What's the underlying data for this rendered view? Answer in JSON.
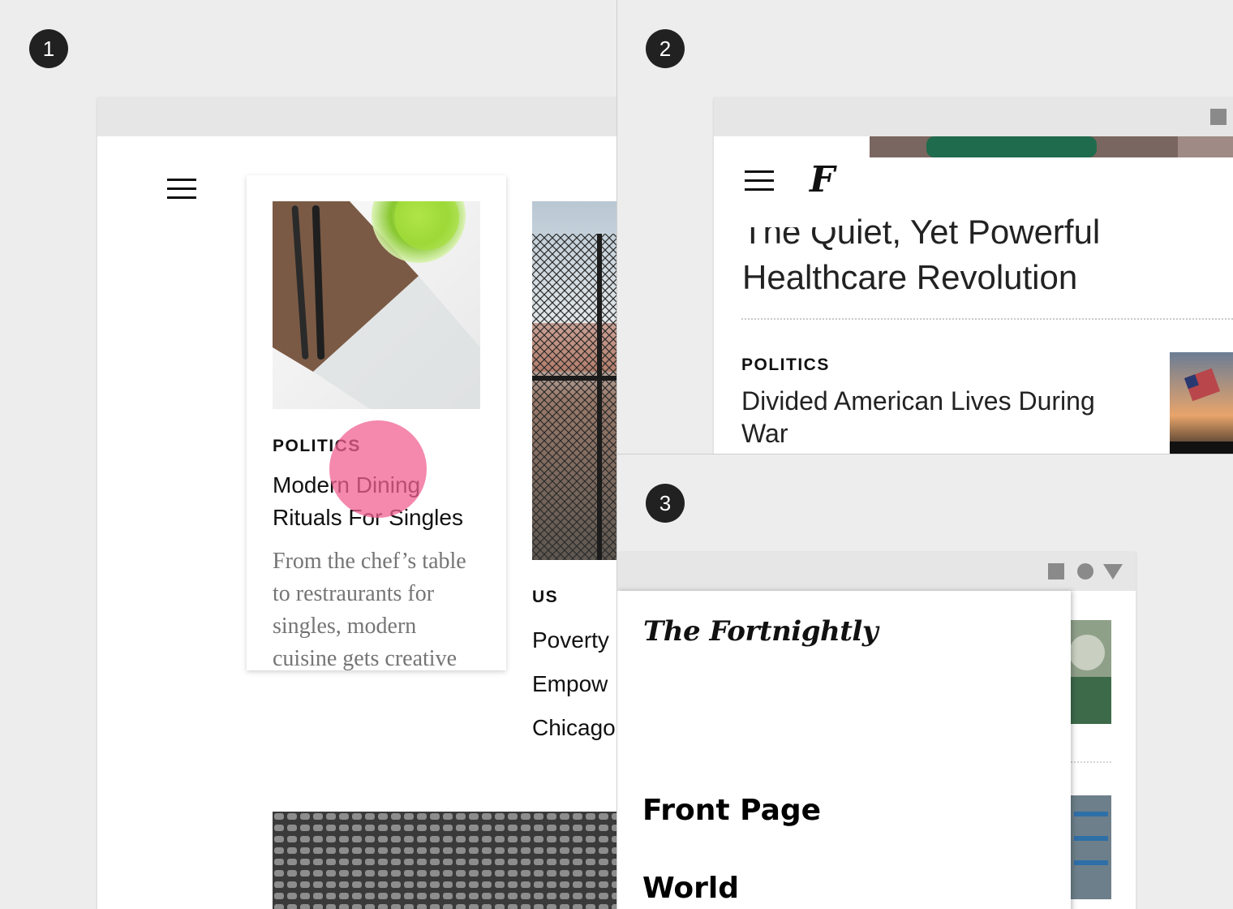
{
  "steps": [
    "1",
    "2",
    "3"
  ],
  "panel1": {
    "card": {
      "kicker": "POLITICS",
      "headline": "Modern Dining Rituals For Singles",
      "summary": "From the chef’s table to restraurants for singles, modern cuisine gets creative"
    },
    "card2": {
      "kicker": "US",
      "headline": "Poverty Empow Chicago"
    },
    "touch_indicator_color": "#f06292"
  },
  "panel2": {
    "logo": "F",
    "headline": "The Quiet, Yet Powerful Healthcare Revolution",
    "kicker": "POLITICS",
    "story": "Divided American Lives During War"
  },
  "panel3": {
    "masthead": "The Fortnightly",
    "nav": [
      "Front Page",
      "World"
    ]
  }
}
